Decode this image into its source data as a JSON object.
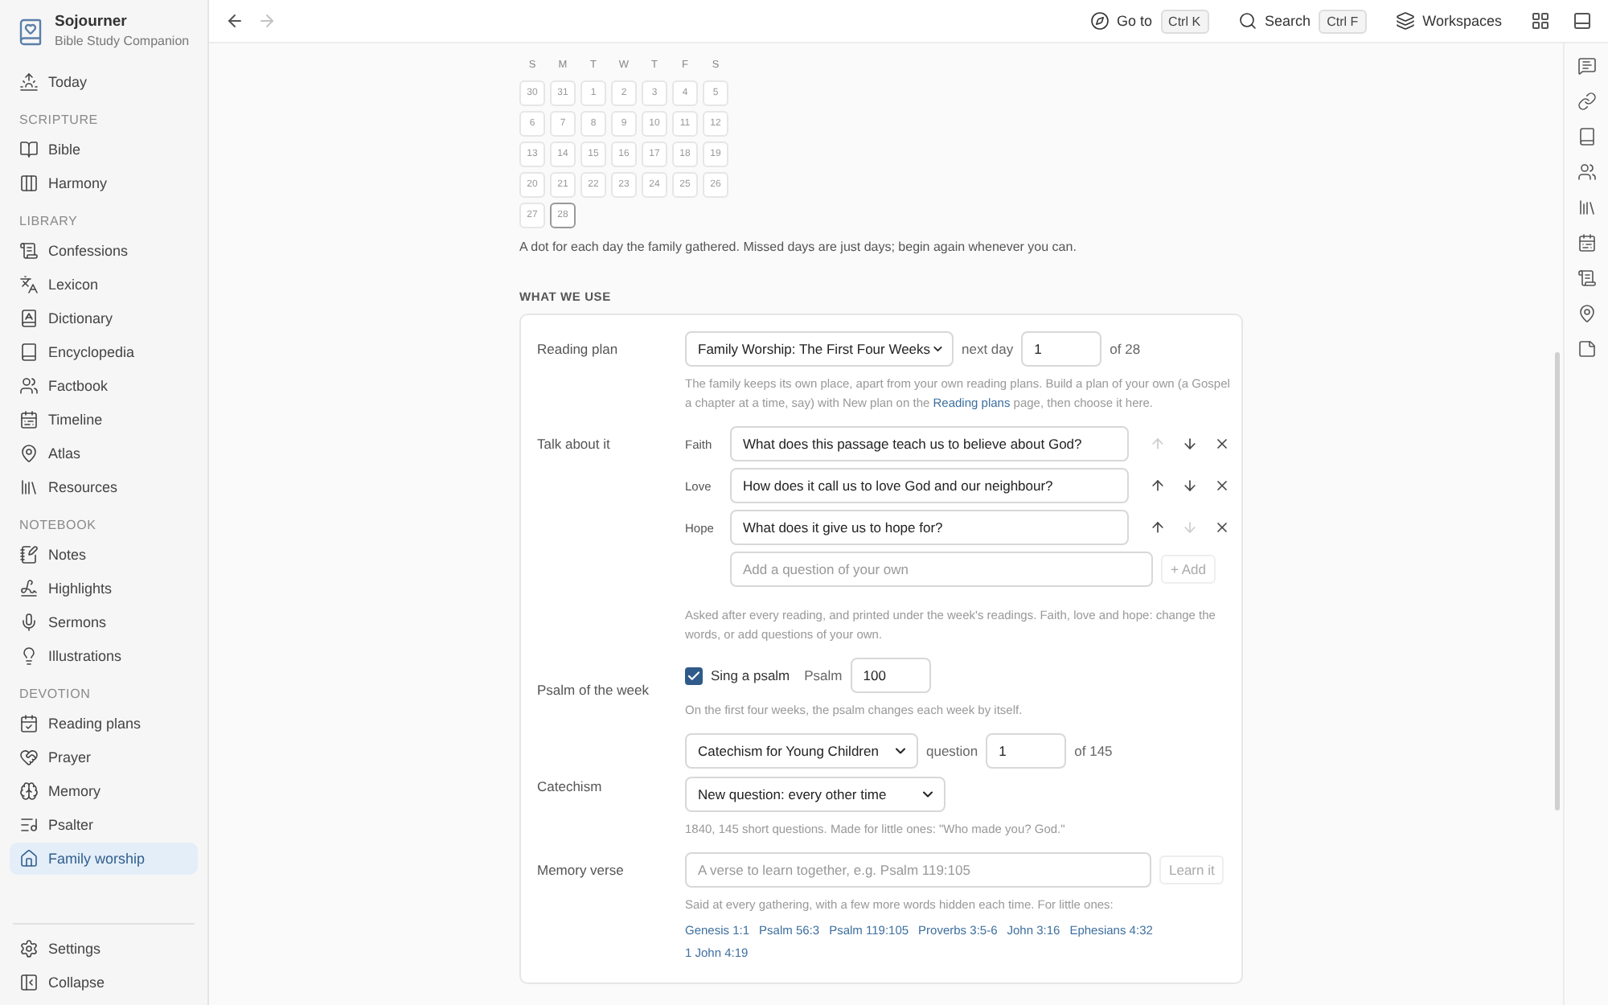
{
  "app": {
    "name": "Sojourner",
    "subtitle": "Bible Study Companion"
  },
  "sidebar": {
    "top": [
      {
        "label": "Today",
        "selected": false
      }
    ],
    "sections": [
      {
        "title": "SCRIPTURE",
        "items": [
          {
            "label": "Bible",
            "selected": false
          },
          {
            "label": "Harmony",
            "selected": false
          }
        ]
      },
      {
        "title": "LIBRARY",
        "items": [
          {
            "label": "Confessions",
            "selected": false
          },
          {
            "label": "Lexicon",
            "selected": false
          },
          {
            "label": "Dictionary",
            "selected": false
          },
          {
            "label": "Encyclopedia",
            "selected": false
          },
          {
            "label": "Factbook",
            "selected": false
          },
          {
            "label": "Timeline",
            "selected": false
          },
          {
            "label": "Atlas",
            "selected": false
          },
          {
            "label": "Resources",
            "selected": false
          }
        ]
      },
      {
        "title": "NOTEBOOK",
        "items": [
          {
            "label": "Notes",
            "selected": false
          },
          {
            "label": "Highlights",
            "selected": false
          },
          {
            "label": "Sermons",
            "selected": false
          },
          {
            "label": "Illustrations",
            "selected": false
          }
        ]
      },
      {
        "title": "DEVOTION",
        "items": [
          {
            "label": "Reading plans",
            "selected": false
          },
          {
            "label": "Prayer",
            "selected": false
          },
          {
            "label": "Memory",
            "selected": false
          },
          {
            "label": "Psalter",
            "selected": false
          },
          {
            "label": "Family worship",
            "selected": true
          }
        ]
      }
    ],
    "bottom": [
      {
        "label": "Settings",
        "selected": false
      },
      {
        "label": "Collapse",
        "selected": false
      }
    ]
  },
  "toolbar": {
    "back_disabled": false,
    "forward_disabled": true,
    "actions": [
      {
        "label": "Go to",
        "shortcut": "Ctrl K"
      },
      {
        "label": "Search",
        "shortcut": "Ctrl F"
      },
      {
        "label": "Workspaces"
      }
    ]
  },
  "calendar": {
    "weekdays": [
      "S",
      "M",
      "T",
      "W",
      "T",
      "F",
      "S"
    ],
    "days": [
      {
        "label": "30",
        "today": false
      },
      {
        "label": "31",
        "today": false
      },
      {
        "label": "1",
        "today": false
      },
      {
        "label": "2",
        "today": false
      },
      {
        "label": "3",
        "today": false
      },
      {
        "label": "4",
        "today": false
      },
      {
        "label": "5",
        "today": false
      },
      {
        "label": "6",
        "today": false
      },
      {
        "label": "7",
        "today": false
      },
      {
        "label": "8",
        "today": false
      },
      {
        "label": "9",
        "today": false
      },
      {
        "label": "10",
        "today": false
      },
      {
        "label": "11",
        "today": false
      },
      {
        "label": "12",
        "today": false
      },
      {
        "label": "13",
        "today": false
      },
      {
        "label": "14",
        "today": false
      },
      {
        "label": "15",
        "today": false
      },
      {
        "label": "16",
        "today": false
      },
      {
        "label": "17",
        "today": false
      },
      {
        "label": "18",
        "today": false
      },
      {
        "label": "19",
        "today": false
      },
      {
        "label": "20",
        "today": false
      },
      {
        "label": "21",
        "today": false
      },
      {
        "label": "22",
        "today": false
      },
      {
        "label": "23",
        "today": false
      },
      {
        "label": "24",
        "today": false
      },
      {
        "label": "25",
        "today": false
      },
      {
        "label": "26",
        "today": false
      },
      {
        "label": "27",
        "today": false
      },
      {
        "label": "28",
        "today": true
      }
    ],
    "note": "A dot for each day the family gathered. Missed days are just days; begin again whenever you can."
  },
  "section_title": "WHAT WE USE",
  "reading_plan": {
    "label": "Reading plan",
    "plan": "Family Worship: The First Four Weeks",
    "next_label": "next day",
    "next_value": "1",
    "of": "of 28",
    "help_before": "The family keeps its own place, apart from your own reading plans. Build a plan of your own (a Gospel a chapter at a time, say) with New plan on the ",
    "help_link": "Reading plans",
    "help_after": " page, then choose it here."
  },
  "talk": {
    "label": "Talk about it",
    "questions": [
      {
        "tag": "Faith",
        "value": "What does this passage teach us to believe about God?",
        "up_disabled": true,
        "down_disabled": false
      },
      {
        "tag": "Love",
        "value": "How does it call us to love God and our neighbour?",
        "up_disabled": false,
        "down_disabled": false
      },
      {
        "tag": "Hope",
        "value": "What does it give us to hope for?",
        "up_disabled": false,
        "down_disabled": true
      }
    ],
    "add_placeholder": "Add a question of your own",
    "add_button": "+ Add",
    "help": "Asked after every reading, and printed under the week's readings. Faith, love and hope: change the words, or add questions of your own."
  },
  "psalm": {
    "label": "Psalm of the week",
    "checked": true,
    "check_label": "Sing a psalm",
    "psalm_label": "Psalm",
    "psalm_value": "100",
    "help": "On the first four weeks, the psalm changes each week by itself."
  },
  "catechism": {
    "label": "Catechism",
    "catechism": "Catechism for Young Children",
    "question_label": "question",
    "question_value": "1",
    "of": "of 145",
    "frequency": "New question: every other time",
    "help": "1840, 145 short questions. Made for little ones: \"Who made you? God.\""
  },
  "memory_verse": {
    "label": "Memory verse",
    "placeholder": "A verse to learn together, e.g. Psalm 119:105",
    "button": "Learn it",
    "help": "Said at every gathering, with a few more words hidden each time. For little ones:",
    "suggestions": [
      "Genesis 1:1",
      "Psalm 56:3",
      "Psalm 119:105",
      "Proverbs 3:5-6",
      "John 3:16",
      "Ephesians 4:32",
      "1 John 4:19"
    ]
  }
}
